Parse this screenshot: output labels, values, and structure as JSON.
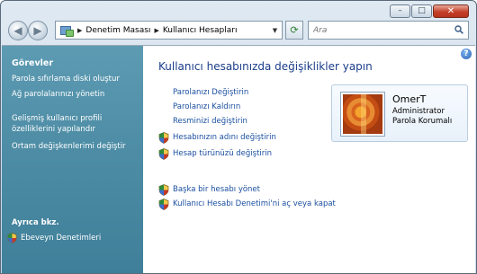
{
  "window": {
    "minimize_icon": "minimize-icon",
    "maximize_icon": "maximize-icon",
    "close_icon": "close-icon"
  },
  "nav": {
    "back_icon": "back-arrow-icon",
    "forward_icon": "forward-arrow-icon",
    "breadcrumbs": [
      "Denetim Masası",
      "Kullanıcı Hesapları"
    ],
    "search_placeholder": "Ara",
    "refresh_icon": "refresh-icon",
    "search_icon": "search-icon"
  },
  "sidebar": {
    "title": "Görevler",
    "links": [
      "Parola sıfırlama diski oluştur",
      "Ağ parolalarınızı yönetin",
      "Gelişmiş kullanıcı profili özelliklerini yapılandır",
      "Ortam değişkenlerimi değiştir"
    ],
    "see_also_title": "Ayrıca bkz.",
    "see_also_link": "Ebeveyn Denetimleri"
  },
  "main": {
    "title": "Kullanıcı hesabınızda değişiklikler yapın",
    "tasks": [
      {
        "label": "Parolanızı Değiştirin",
        "shield": false
      },
      {
        "label": "Parolanızı Kaldırın",
        "shield": false
      },
      {
        "label": "Resminizi değiştirin",
        "shield": false
      },
      {
        "label": "Hesabınızın adını değiştirin",
        "shield": true
      },
      {
        "label": "Hesap türünüzü değiştirin",
        "shield": true
      }
    ],
    "other_tasks": [
      {
        "label": "Başka bir hesabı yönet",
        "shield": true
      },
      {
        "label": "Kullanıcı Hesabı Denetimi'ni aç veya kapat",
        "shield": true
      }
    ]
  },
  "user": {
    "name": "OmerT",
    "role": "Administrator",
    "password_status": "Parola Korumalı"
  },
  "colors": {
    "sidebar": "#4f8ea6",
    "link": "#1b4fa0",
    "title": "#1b3d8a",
    "close_button": "#c4402a"
  }
}
